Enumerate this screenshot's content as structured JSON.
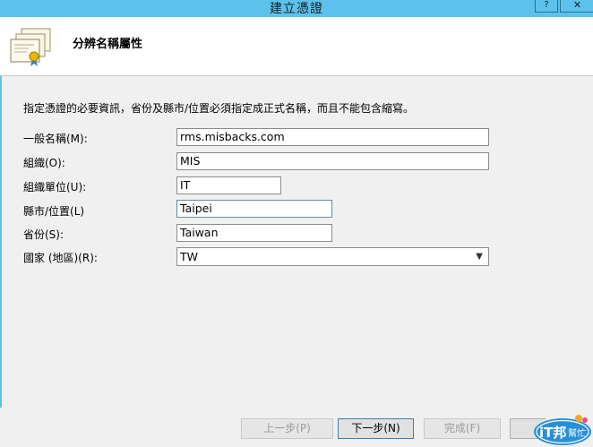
{
  "window": {
    "title": "建立憑證",
    "help_glyph": "?",
    "close_glyph": "✕"
  },
  "header": {
    "heading": "分辨名稱屬性",
    "icon": "certificate-icon"
  },
  "instructions": "指定憑證的必要資訊，省份及縣市/位置必須指定成正式名稱，而且不能包含縮寫。",
  "form": {
    "common_name": {
      "label": "一般名稱(M):",
      "value": "rms.misbacks.com"
    },
    "organization": {
      "label": "組織(O):",
      "value": "MIS"
    },
    "org_unit": {
      "label": "組織單位(U):",
      "value": "IT"
    },
    "city": {
      "label": "縣市/位置(L)",
      "value": "Taipei"
    },
    "state": {
      "label": "省份(S):",
      "value": "Taiwan"
    },
    "country": {
      "label": "國家 (地區)(R):",
      "value": "TW"
    }
  },
  "buttons": {
    "back": "上一步(P)",
    "next": "下一步(N)",
    "finish": "完成(F)"
  },
  "watermark": {
    "text": "iT邦幫忙",
    "color": "#2a8fd6"
  }
}
